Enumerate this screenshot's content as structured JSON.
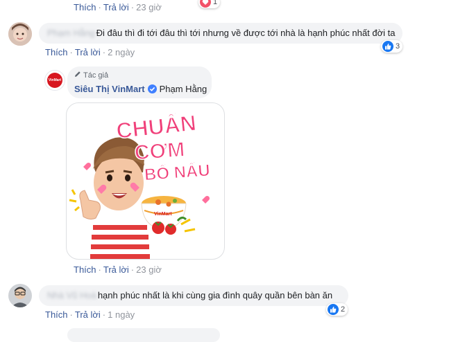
{
  "comment0": {
    "actions": {
      "like": "Thích",
      "reply": "Trả lời",
      "time": "23 giờ"
    },
    "reaction_count": "1",
    "reaction_icon": "heart-icon"
  },
  "comment1": {
    "author": "Phạm Hằng",
    "text": "Đi đâu thì đi tới đâu thì tới nhưng về được tới nhà là hạnh phúc nhất đời ta",
    "actions": {
      "like": "Thích",
      "reply": "Trả lời",
      "time": "2 ngày"
    },
    "reaction_count": "3",
    "reaction_icon": "like-icon"
  },
  "reply": {
    "badge": "Tác giả",
    "author": "Siêu Thị VinMart",
    "tagged": "Phạm Hằng",
    "logo_text": "VinMart",
    "sticker": {
      "lines": [
        "CHUẨN",
        "CƠM",
        "BỐ NẤU"
      ],
      "bowl_brand": "VinMart"
    },
    "actions": {
      "like": "Thích",
      "reply": "Trả lời",
      "time": "23 giờ"
    }
  },
  "comment2": {
    "author": "Nhà Vũ Hoà",
    "text": "hạnh phúc nhất là khi cùng gia đình quây quần bên bàn ăn",
    "actions": {
      "like": "Thích",
      "reply": "Trả lời",
      "time": "1 ngày"
    },
    "reaction_count": "2",
    "reaction_icon": "like-icon"
  },
  "colors": {
    "link": "#385898",
    "bubble": "#f2f3f5",
    "like": "#1877f2",
    "heart": "#f25268",
    "brand_red": "#d7161f",
    "sticker_pink": "#f0407a"
  }
}
